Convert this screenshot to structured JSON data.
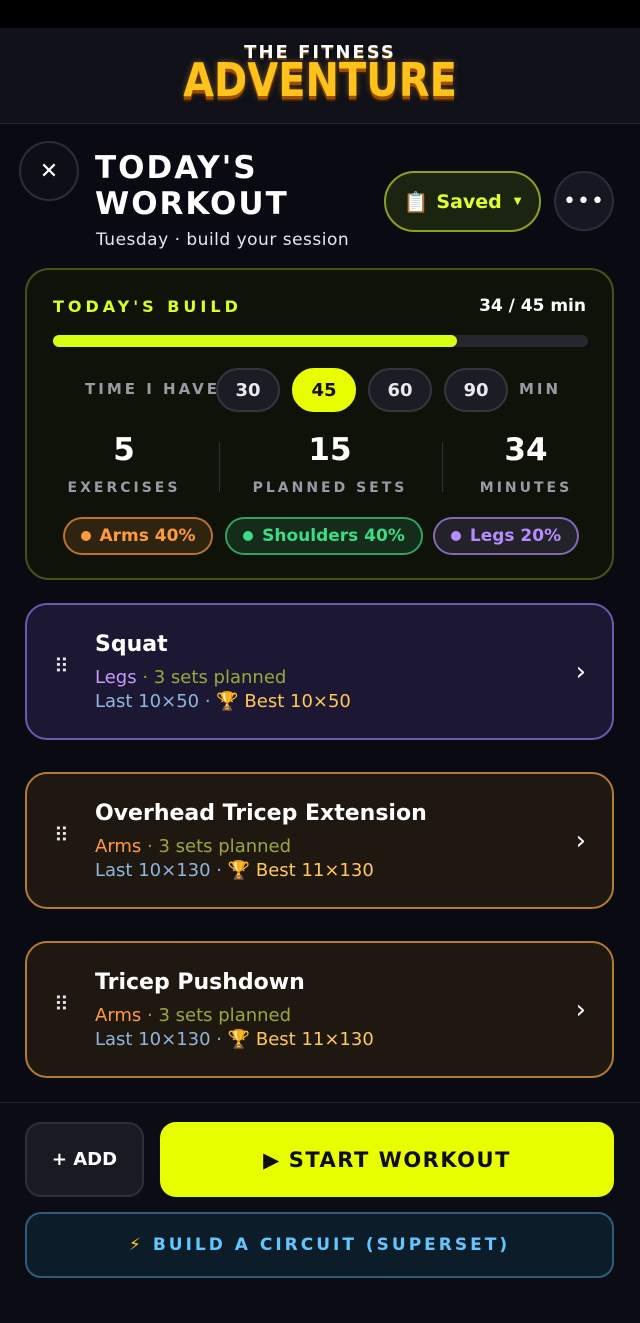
{
  "app": {
    "logo_top": "THE FITNESS",
    "logo_main": "ADVENTURE"
  },
  "header": {
    "title_line1": "TODAY'S",
    "title_line2": "WORKOUT",
    "subtitle": "Tuesday · build your session",
    "saved_label": "Saved",
    "close_glyph": "✕",
    "more_glyph": "•••"
  },
  "build": {
    "label": "TODAY'S BUILD",
    "minutes_text": "34 / 45 min",
    "progress_fraction": 0.756,
    "time_label": "TIME I HAVE",
    "time_unit": "MIN",
    "time_options": [
      "30",
      "45",
      "60",
      "90"
    ],
    "selected_time": "45",
    "stats": [
      {
        "value": "5",
        "label": "EXERCISES"
      },
      {
        "value": "15",
        "label": "PLANNED SETS"
      },
      {
        "value": "34",
        "label": "MINUTES"
      }
    ],
    "chips": [
      {
        "label": "Arms 40%",
        "color": "#ff9a3d"
      },
      {
        "label": "Shoulders 40%",
        "color": "#3ddc84"
      },
      {
        "label": "Legs 20%",
        "color": "#b48cff"
      }
    ]
  },
  "exercises": [
    {
      "name": "Squat",
      "muscle": "Legs",
      "muscle_color": "#c79bff",
      "sets": " · 3 sets planned",
      "last": "Last 10×50",
      "best": "🏆 Best 10×50"
    },
    {
      "name": "Overhead Tricep Extension",
      "muscle": "Arms",
      "muscle_color": "#ff9a3d",
      "sets": " · 3 sets planned",
      "last": "Last 10×130",
      "best": "🏆 Best 11×130"
    },
    {
      "name": "Tricep Pushdown",
      "muscle": "Arms",
      "muscle_color": "#ff9a3d",
      "sets": " · 3 sets planned",
      "last": "Last 10×130",
      "best": "🏆 Best 11×130"
    }
  ],
  "footer": {
    "add_label": "+ ADD",
    "start_label": "START WORKOUT",
    "circuit_label": "BUILD A CIRCUIT (SUPERSET)"
  },
  "colors": {
    "accent": "#e8ff00",
    "sets_text": "#9aa83a",
    "last_text": "#8fb6de",
    "best_text": "#ffc857"
  }
}
